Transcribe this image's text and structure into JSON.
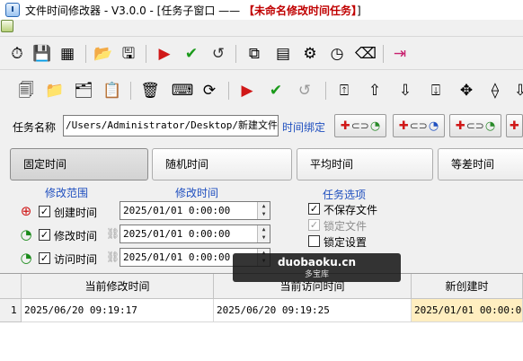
{
  "window": {
    "title": "文件时间修改器  - V3.0.0 - [任务子窗口 —— ",
    "title_highlight": "【未命名修改时间任务】",
    "title_end": "]"
  },
  "toolbar1": {
    "icons": [
      "clock-settings-icon",
      "save-settings-icon",
      "color-grid-icon",
      "open-folder-icon",
      "save-disk-icon",
      "run-icon",
      "check-icon",
      "undo-icon",
      "window-capture-icon",
      "file-list-icon",
      "gear-icon",
      "time-file-icon",
      "clean-icon",
      "exit-icon"
    ]
  },
  "toolbar2": {
    "icons": [
      "add-files-icon",
      "add-folder-icon",
      "add-multiple-icon",
      "clipboard-icon",
      "delete-icon",
      "sweep-icon",
      "refresh-icon",
      "run-icon",
      "check-icon",
      "undo-icon",
      "move-top-icon",
      "move-up-icon",
      "move-down-icon",
      "move-bottom-icon",
      "expand-all-icon",
      "collapse-all-icon",
      "sort-icon"
    ]
  },
  "task": {
    "name_label": "任务名称",
    "name_value": "/Users/Administrator/Desktop/新建文件夹",
    "time_bind_label": "时间绑定"
  },
  "tabs": [
    {
      "label": "固定时间",
      "active": true
    },
    {
      "label": "随机时间",
      "active": false
    },
    {
      "label": "平均时间",
      "active": false
    },
    {
      "label": "等差时间",
      "active": false
    }
  ],
  "sections": {
    "range_label": "修改范围",
    "time_label": "修改时间",
    "options_label": "任务选项"
  },
  "rows": [
    {
      "label": "创建时间",
      "checked": true,
      "value": "2025/01/01  0:00:00"
    },
    {
      "label": "修改时间",
      "checked": true,
      "value": "2025/01/01  0:00:00"
    },
    {
      "label": "访问时间",
      "checked": true,
      "value": "2025/01/01  0:00:00"
    }
  ],
  "options": [
    {
      "label": "不保存文件",
      "checked": true,
      "disabled": false
    },
    {
      "label": "锁定文件",
      "checked": true,
      "disabled": true
    },
    {
      "label": "锁定设置",
      "checked": false,
      "disabled": false
    }
  ],
  "watermark": {
    "main": "duobaoku.cn",
    "sub": "多宝库"
  },
  "table": {
    "columns": [
      "当前修改时间",
      "当前访问时间",
      "新创建时"
    ],
    "rows": [
      {
        "index": "1",
        "cells": [
          "2025/06/20 09:19:17",
          "2025/06/20 09:19:25",
          "2025/01/01 00:00:00"
        ]
      }
    ]
  }
}
